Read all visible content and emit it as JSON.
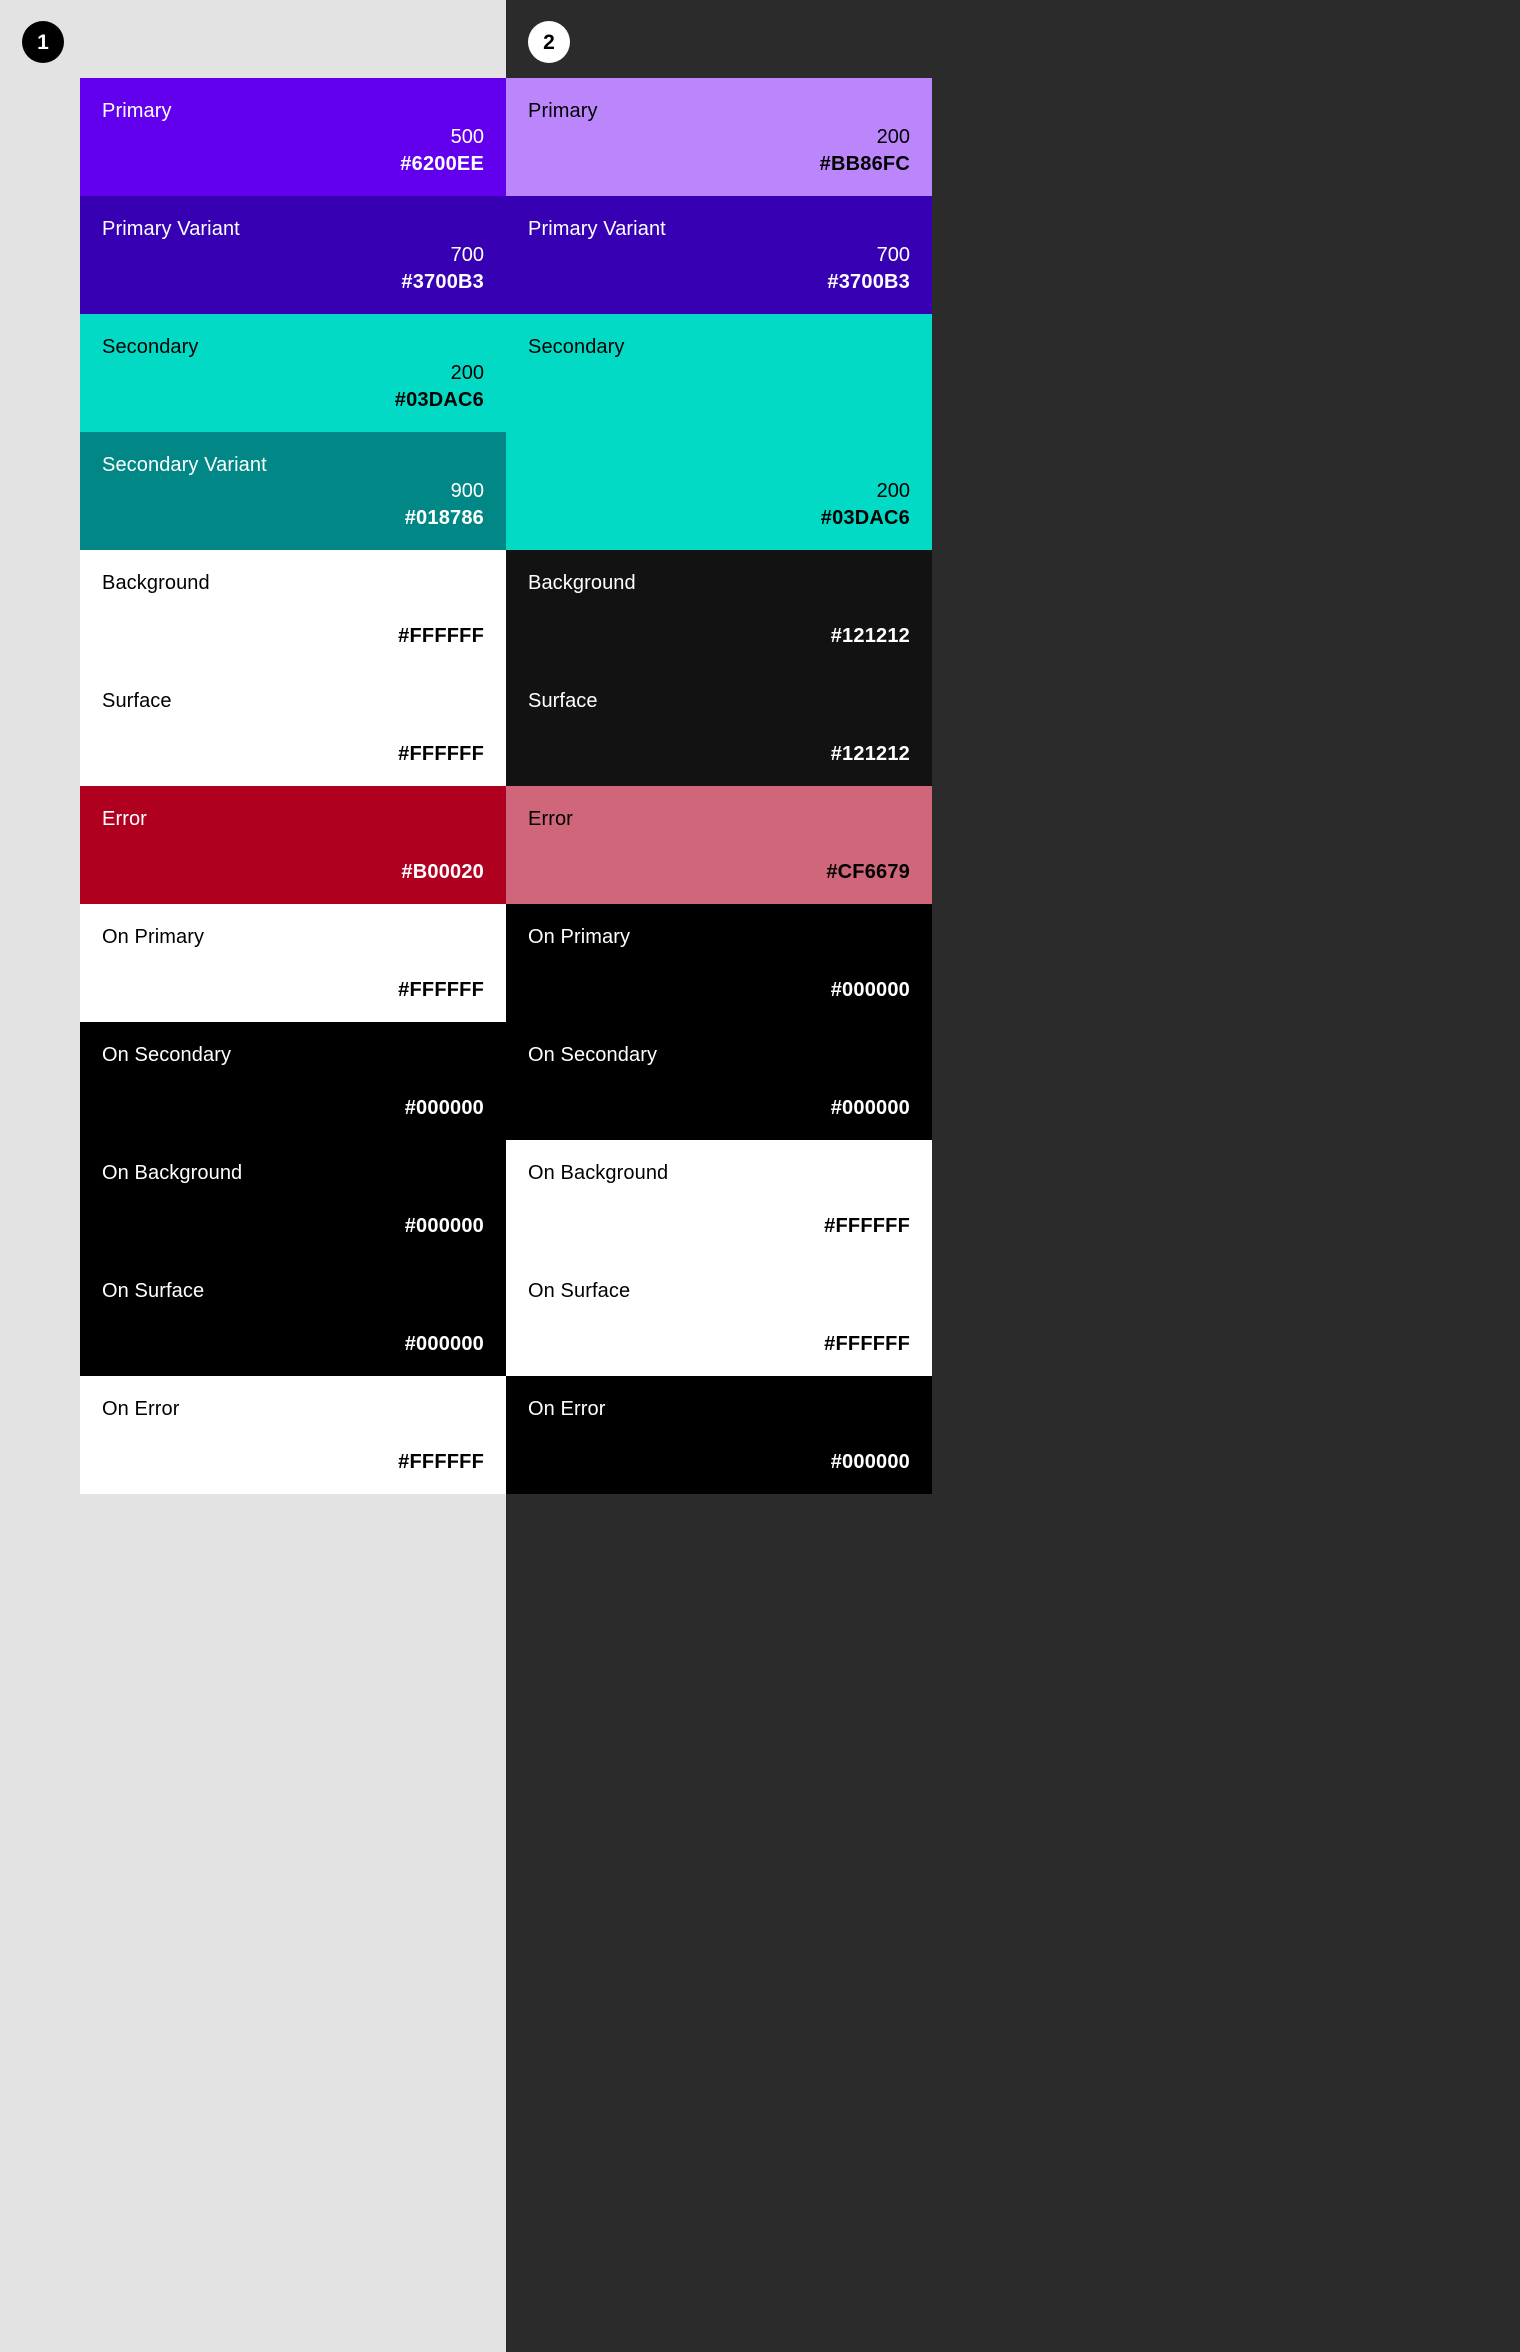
{
  "badges": [
    {
      "label": "1",
      "bg": "#000000",
      "fg": "#FFFFFF"
    },
    {
      "label": "2",
      "bg": "#FFFFFF",
      "fg": "#000000"
    }
  ],
  "page": {
    "light_panel_bg": "#E3E3E3",
    "dark_panel_bg": "#2B2B2B"
  },
  "columns": [
    {
      "id": "light-theme",
      "swatches": [
        {
          "name": "Primary",
          "tone": "500",
          "hex": "#6200EE",
          "bg": "#6200EE",
          "fg": "#FFFFFF",
          "size": "std"
        },
        {
          "name": "Primary Variant",
          "tone": "700",
          "hex": "#3700B3",
          "bg": "#3700B3",
          "fg": "#FFFFFF",
          "size": "std"
        },
        {
          "name": "Secondary",
          "tone": "200",
          "hex": "#03DAC6",
          "bg": "#03DAC6",
          "fg": "#000000",
          "size": "std"
        },
        {
          "name": "Secondary Variant",
          "tone": "900",
          "hex": "#018786",
          "bg": "#018786",
          "fg": "#FFFFFF",
          "size": "std"
        },
        {
          "name": "Background",
          "tone": "",
          "hex": "#FFFFFF",
          "bg": "#FFFFFF",
          "fg": "#000000",
          "size": "std"
        },
        {
          "name": "Surface",
          "tone": "",
          "hex": "#FFFFFF",
          "bg": "#FFFFFF",
          "fg": "#000000",
          "size": "std"
        },
        {
          "name": "Error",
          "tone": "",
          "hex": "#B00020",
          "bg": "#B00020",
          "fg": "#FFFFFF",
          "size": "std"
        },
        {
          "name": "On Primary",
          "tone": "",
          "hex": "#FFFFFF",
          "bg": "#FFFFFF",
          "fg": "#000000",
          "size": "std"
        },
        {
          "name": "On Secondary",
          "tone": "",
          "hex": "#000000",
          "bg": "#000000",
          "fg": "#FFFFFF",
          "size": "std"
        },
        {
          "name": "On Background",
          "tone": "",
          "hex": "#000000",
          "bg": "#000000",
          "fg": "#FFFFFF",
          "size": "std"
        },
        {
          "name": "On Surface",
          "tone": "",
          "hex": "#000000",
          "bg": "#000000",
          "fg": "#FFFFFF",
          "size": "std"
        },
        {
          "name": "On Error",
          "tone": "",
          "hex": "#FFFFFF",
          "bg": "#FFFFFF",
          "fg": "#000000",
          "size": "std"
        }
      ]
    },
    {
      "id": "dark-theme",
      "swatches": [
        {
          "name": "Primary",
          "tone": "200",
          "hex": "#BB86FC",
          "bg": "#BB86FC",
          "fg": "#000000",
          "size": "std"
        },
        {
          "name": "Primary Variant",
          "tone": "700",
          "hex": "#3700B3",
          "bg": "#3700B3",
          "fg": "#FFFFFF",
          "size": "std"
        },
        {
          "name": "Secondary",
          "tone": "200",
          "hex": "#03DAC6",
          "bg": "#03DAC6",
          "fg": "#000000",
          "size": "tall"
        },
        {
          "name": "Background",
          "tone": "",
          "hex": "#121212",
          "bg": "#121212",
          "fg": "#FFFFFF",
          "size": "std"
        },
        {
          "name": "Surface",
          "tone": "",
          "hex": "#121212",
          "bg": "#121212",
          "fg": "#FFFFFF",
          "size": "std"
        },
        {
          "name": "Error",
          "tone": "",
          "hex": "#CF6679",
          "bg": "#CF6679",
          "fg": "#000000",
          "size": "std"
        },
        {
          "name": "On Primary",
          "tone": "",
          "hex": "#000000",
          "bg": "#000000",
          "fg": "#FFFFFF",
          "size": "std"
        },
        {
          "name": "On Secondary",
          "tone": "",
          "hex": "#000000",
          "bg": "#000000",
          "fg": "#FFFFFF",
          "size": "std"
        },
        {
          "name": "On Background",
          "tone": "",
          "hex": "#FFFFFF",
          "bg": "#FFFFFF",
          "fg": "#000000",
          "size": "std"
        },
        {
          "name": "On Surface",
          "tone": "",
          "hex": "#FFFFFF",
          "bg": "#FFFFFF",
          "fg": "#000000",
          "size": "std"
        },
        {
          "name": "On Error",
          "tone": "",
          "hex": "#000000",
          "bg": "#000000",
          "fg": "#FFFFFF",
          "size": "std"
        }
      ]
    }
  ]
}
